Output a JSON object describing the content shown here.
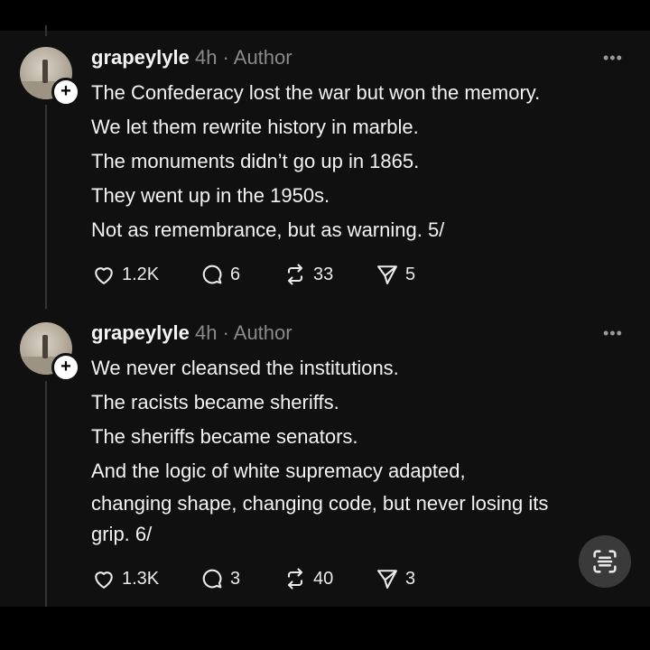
{
  "posts": [
    {
      "username": "grapeylyle",
      "meta": " 4h · Author",
      "lines": [
        "The Confederacy lost the war but won the memory.",
        "We let them rewrite history in marble.",
        "The monuments didn’t go up in 1865.",
        "They went up in the 1950s.",
        "Not as remembrance, but as warning. 5/"
      ],
      "likes": "1.2K",
      "comments": "6",
      "reposts": "33",
      "shares": "5"
    },
    {
      "username": "grapeylyle",
      "meta": " 4h · Author",
      "lines": [
        "We never cleansed the institutions.",
        "The racists became sheriffs.",
        "The sheriffs became senators.",
        "And the logic of white supremacy adapted,",
        "changing shape, changing code, but never losing its",
        "grip. 6/"
      ],
      "likes": "1.3K",
      "comments": "3",
      "reposts": "40",
      "shares": "3"
    }
  ],
  "icons": {
    "more": "more-icon",
    "like": "heart-icon",
    "comment": "comment-icon",
    "repost": "repost-icon",
    "share": "share-icon",
    "follow": "plus-icon",
    "scan": "scan-text-icon"
  },
  "colors": {
    "background": "#101010",
    "text": "#f3f3f3",
    "meta": "#8a8a8a"
  }
}
